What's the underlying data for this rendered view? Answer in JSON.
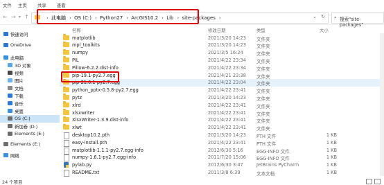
{
  "ribbon_tabs": [
    "文件",
    "主页",
    "共享",
    "查看"
  ],
  "address": {
    "crumbs": [
      "此电脑",
      "OS (C:)",
      "Python27",
      "ArcGIS10.2",
      "Lib",
      "site-packages"
    ],
    "search_placeholder": "搜索\"site-packages\""
  },
  "columns": {
    "name": "名称",
    "date": "修改日期",
    "type": "类型",
    "size": "大小"
  },
  "sidebar": {
    "items": [
      {
        "label": "快速访问",
        "icon": "star-icon",
        "color": "#2b78d6"
      },
      {
        "label": "OneDrive",
        "icon": "cloud-icon",
        "color": "#2b78d6"
      },
      {
        "label": "此电脑",
        "icon": "computer-icon",
        "color": "#3b8fe0"
      },
      {
        "label": "3D 对象",
        "icon": "cube-icon",
        "color": "#59a6e8"
      },
      {
        "label": "视频",
        "icon": "video-icon",
        "color": "#4a4a4a"
      },
      {
        "label": "图片",
        "icon": "picture-icon",
        "color": "#6bb0e8"
      },
      {
        "label": "文档",
        "icon": "document-icon",
        "color": "#8a8a8a"
      },
      {
        "label": "下载",
        "icon": "download-icon",
        "color": "#2b78d6"
      },
      {
        "label": "音乐",
        "icon": "music-icon",
        "color": "#2b78d6"
      },
      {
        "label": "桌面",
        "icon": "desktop-icon",
        "color": "#3b8fe0"
      },
      {
        "label": "OS (C:)",
        "icon": "drive-icon",
        "color": "#6d6d6d"
      },
      {
        "label": "新加卷 (D:)",
        "icon": "drive-icon",
        "color": "#6d6d6d"
      },
      {
        "label": "Elements (E:)",
        "icon": "drive-icon",
        "color": "#6d6d6d"
      },
      {
        "label": "Elements (E:)",
        "icon": "drive-icon",
        "color": "#6d6d6d"
      },
      {
        "label": "网络",
        "icon": "network-icon",
        "color": "#3b8fe0"
      }
    ]
  },
  "files": [
    {
      "name": "matplotlib",
      "date": "2021/3/20 14:23",
      "type": "文件夹",
      "size": "",
      "kind": "folder"
    },
    {
      "name": "mpl_toolkits",
      "date": "2021/3/20 14:23",
      "type": "文件夹",
      "size": "",
      "kind": "folder"
    },
    {
      "name": "numpy",
      "date": "2021/3/5 16:24",
      "type": "文件夹",
      "size": "",
      "kind": "folder"
    },
    {
      "name": "PIL",
      "date": "2021/4/22 23:34",
      "type": "文件夹",
      "size": "",
      "kind": "folder"
    },
    {
      "name": "Pillow-6.2.2.dist-info",
      "date": "2021/4/22 23:34",
      "type": "文件夹",
      "size": "",
      "kind": "folder"
    },
    {
      "name": "pip-19.1-py2.7.egg",
      "date": "2021/4/21 23:38",
      "type": "文件夹",
      "size": "",
      "kind": "folder"
    },
    {
      "name": "pip-21.0.1-py2.7.egg",
      "date": "2021/4/22 23:04",
      "type": "文件夹",
      "size": "",
      "kind": "folder"
    },
    {
      "name": "python_pptx-0.5.8-py2.7.egg",
      "date": "2021/4/22 23:41",
      "type": "文件夹",
      "size": "",
      "kind": "folder"
    },
    {
      "name": "pytz",
      "date": "2021/3/20 14:23",
      "type": "文件夹",
      "size": "",
      "kind": "folder"
    },
    {
      "name": "xlrd",
      "date": "2021/4/22 23:41",
      "type": "文件夹",
      "size": "",
      "kind": "folder"
    },
    {
      "name": "xlsxwriter",
      "date": "2021/4/22 23:41",
      "type": "文件夹",
      "size": "",
      "kind": "folder"
    },
    {
      "name": "XlsxWriter-1.3.9.dist-info",
      "date": "2021/4/22 23:41",
      "type": "文件夹",
      "size": "",
      "kind": "folder"
    },
    {
      "name": "xlwt",
      "date": "2021/4/22 23:41",
      "type": "文件夹",
      "size": "",
      "kind": "folder"
    },
    {
      "name": "desktop10.2.pth",
      "date": "2021/3/20 14:23",
      "type": "PTH 文件",
      "size": "1 KB",
      "kind": "file"
    },
    {
      "name": "easy-install.pth",
      "date": "2021/4/22 23:41",
      "type": "PTH 文件",
      "size": "1 KB",
      "kind": "file"
    },
    {
      "name": "matplotlib-1.1.1-py2.7.egg-info",
      "date": "2012/6/30 5:16",
      "type": "EGG-INFO 文件",
      "size": "1 KB",
      "kind": "file"
    },
    {
      "name": "numpy-1.6.1-py2.7.egg-info",
      "date": "2011/7/20 15:06",
      "type": "EGG-INFO 文件",
      "size": "1 KB",
      "kind": "file"
    },
    {
      "name": "pylab.py",
      "date": "2012/6/30 3:47",
      "type": "JetBrains PyCharm",
      "size": "1 KB",
      "kind": "py"
    },
    {
      "name": "README.txt",
      "date": "2011/3/8 6:39",
      "type": "文本文档",
      "size": "1 KB",
      "kind": "file"
    }
  ],
  "status": {
    "count": "24 个项目"
  },
  "colors": {
    "highlight": "#e00000",
    "selected_row": "#e5f1fb",
    "sidebar_selected": "#cce4f7"
  }
}
